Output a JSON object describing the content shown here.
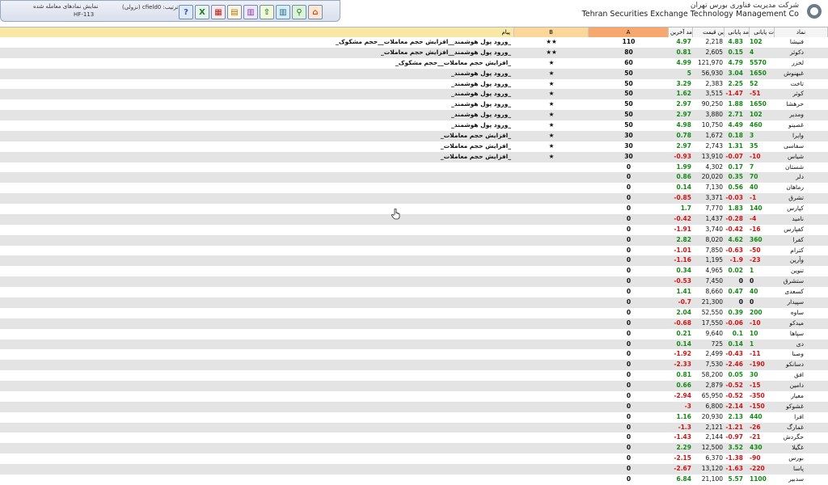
{
  "header": {
    "show_traded_label": "نمایش نمادهای معامله شده",
    "code": "HF-113",
    "sort_label": "ترتیب: cfield0 (نزولی)",
    "company_fa": "شرکت مدیریت فناوری بورس تهران",
    "company_en": "Tehran Securities Exchange Technology Management Co",
    "toolbar": [
      {
        "name": "help-button",
        "icon": "question-icon",
        "glyph": "?",
        "color": "#2a5db0",
        "bg": "#dfe9f7"
      },
      {
        "name": "excel-button",
        "icon": "excel-icon",
        "glyph": "X",
        "color": "#1e7a32",
        "bg": "#e9f4ea"
      },
      {
        "name": "grid-button",
        "icon": "grid-icon",
        "glyph": "▦",
        "color": "#b02020",
        "bg": "#fbe9e9"
      },
      {
        "name": "preview-button",
        "icon": "document-icon",
        "glyph": "▤",
        "color": "#a07a20",
        "bg": "#fff6dd"
      },
      {
        "name": "table-button",
        "icon": "table-icon",
        "glyph": "▥",
        "color": "#7a3aa8",
        "bg": "#f1e6f8"
      },
      {
        "name": "up-button",
        "icon": "arrow-up-icon",
        "glyph": "⇧",
        "color": "#1e7a32",
        "bg": "#f3f8d6"
      },
      {
        "name": "columns-button",
        "icon": "columns-icon",
        "glyph": "▥",
        "color": "#1e6a8a",
        "bg": "#d7eef7"
      },
      {
        "name": "search-button",
        "icon": "search-icon",
        "glyph": "⚲",
        "color": "#1a7a1a",
        "bg": "#dff2d9"
      },
      {
        "name": "home-button",
        "icon": "home-icon",
        "glyph": "⌂",
        "color": "#d04a1a",
        "bg": "#fde6d6"
      }
    ]
  },
  "columns": {
    "symbol": "نماد",
    "close_change": "ت پایانی",
    "close_pct": "مد پایانی",
    "last_price": "ین قیمت",
    "last_pct": "مد آخرین",
    "a": "A",
    "b": "B",
    "message": "پیام"
  },
  "colors": {
    "positive": "#148a14",
    "negative": "#d01414",
    "header_a": "#f7a86e",
    "header_b": "#fbd79a",
    "header_msg": "#f9e7a6",
    "header_other": "#f4f4f4"
  },
  "rows": [
    {
      "symbol": "فنیشا",
      "c1": "102",
      "c2": "4.83",
      "c3": "2,218",
      "c4": "4.97",
      "a": "110",
      "b": "★★",
      "msg": "_ورود پول هوشمند__افزایش حجم معاملات__حجم مشکوک_"
    },
    {
      "symbol": "دکوثر",
      "c1": "4",
      "c2": "0.15",
      "c3": "2,605",
      "c4": "0.81",
      "a": "80",
      "b": "★★",
      "msg": "_ورود پول هوشمند__افزایش حجم معاملات_"
    },
    {
      "symbol": "لخزر",
      "c1": "5570",
      "c2": "4.79",
      "c3": "121,970",
      "c4": "4.99",
      "a": "60",
      "b": "★",
      "msg": "_افزایش حجم معاملات__حجم مشکوک_"
    },
    {
      "symbol": "غبهنوش",
      "c1": "1650",
      "c2": "3.04",
      "c3": "56,930",
      "c4": "5",
      "a": "50",
      "b": "★",
      "msg": "_ورود پول هوشمند_"
    },
    {
      "symbol": "تاخت",
      "c1": "52",
      "c2": "2.25",
      "c3": "2,383",
      "c4": "3.29",
      "a": "50",
      "b": "★",
      "msg": "_ورود پول هوشمند_"
    },
    {
      "symbol": "کوثر",
      "c1": "-51",
      "c2": "-1.47",
      "c3": "3,515",
      "c4": "1.62",
      "a": "50",
      "b": "★",
      "msg": "_ورود پول هوشمند_"
    },
    {
      "symbol": "حرهشا",
      "c1": "1650",
      "c2": "1.88",
      "c3": "90,250",
      "c4": "2.97",
      "a": "50",
      "b": "★",
      "msg": "_ورود پول هوشمند_"
    },
    {
      "symbol": "ومدیر",
      "c1": "102",
      "c2": "2.71",
      "c3": "3,880",
      "c4": "2.97",
      "a": "50",
      "b": "★",
      "msg": "_ورود پول هوشمند_"
    },
    {
      "symbol": "غصینو",
      "c1": "460",
      "c2": "4.49",
      "c3": "10,750",
      "c4": "4.98",
      "a": "50",
      "b": "★",
      "msg": "_ورود پول هوشمند_"
    },
    {
      "symbol": "وایرا",
      "c1": "3",
      "c2": "0.18",
      "c3": "1,672",
      "c4": "0.78",
      "a": "30",
      "b": "★",
      "msg": "_افزایش حجم معاملات_"
    },
    {
      "symbol": "سفاسی",
      "c1": "35",
      "c2": "1.31",
      "c3": "2,743",
      "c4": "2.97",
      "a": "30",
      "b": "★",
      "msg": "_افزایش حجم معاملات_"
    },
    {
      "symbol": "شیاس",
      "c1": "-10",
      "c2": "-0.07",
      "c3": "13,910",
      "c4": "-0.93",
      "a": "30",
      "b": "★",
      "msg": "_افزایش حجم معاملات_"
    },
    {
      "symbol": "شستان",
      "c1": "7",
      "c2": "0.17",
      "c3": "4,302",
      "c4": "1.99",
      "a": "0",
      "b": "",
      "msg": ""
    },
    {
      "symbol": "دلر",
      "c1": "70",
      "c2": "0.35",
      "c3": "20,020",
      "c4": "0.86",
      "a": "0",
      "b": "",
      "msg": ""
    },
    {
      "symbol": "رماهان",
      "c1": "40",
      "c2": "0.56",
      "c3": "7,130",
      "c4": "0.14",
      "a": "0",
      "b": "",
      "msg": ""
    },
    {
      "symbol": "تشرق",
      "c1": "-1",
      "c2": "-0.03",
      "c3": "3,371",
      "c4": "-0.85",
      "a": "0",
      "b": "",
      "msg": ""
    },
    {
      "symbol": "کپارس",
      "c1": "140",
      "c2": "1.83",
      "c3": "7,770",
      "c4": "1.7",
      "a": "0",
      "b": "",
      "msg": ""
    },
    {
      "symbol": "نامید",
      "c1": "-4",
      "c2": "-0.28",
      "c3": "1,437",
      "c4": "-0.42",
      "a": "0",
      "b": "",
      "msg": ""
    },
    {
      "symbol": "کفپارس",
      "c1": "-16",
      "c2": "-0.42",
      "c3": "3,740",
      "c4": "-1.91",
      "a": "0",
      "b": "",
      "msg": ""
    },
    {
      "symbol": "کفرا",
      "c1": "360",
      "c2": "4.62",
      "c3": "8,020",
      "c4": "2.82",
      "a": "0",
      "b": "",
      "msg": ""
    },
    {
      "symbol": "کترام",
      "c1": "-50",
      "c2": "-0.63",
      "c3": "7,850",
      "c4": "-1.01",
      "a": "0",
      "b": "",
      "msg": ""
    },
    {
      "symbol": "وآرین",
      "c1": "-23",
      "c2": "-1.9",
      "c3": "1,195",
      "c4": "-1.16",
      "a": "0",
      "b": "",
      "msg": ""
    },
    {
      "symbol": "تنوین",
      "c1": "1",
      "c2": "0.02",
      "c3": "4,965",
      "c4": "0.34",
      "a": "0",
      "b": "",
      "msg": ""
    },
    {
      "symbol": "ستشرق",
      "c1": "0",
      "c2": "0",
      "c3": "7,450",
      "c4": "-0.53",
      "a": "0",
      "b": "",
      "msg": ""
    },
    {
      "symbol": "کسعدی",
      "c1": "40",
      "c2": "0.47",
      "c3": "8,660",
      "c4": "1.41",
      "a": "0",
      "b": "",
      "msg": ""
    },
    {
      "symbol": "سپیدار",
      "c1": "0",
      "c2": "0",
      "c3": "21,300",
      "c4": "-0.7",
      "a": "0",
      "b": "",
      "msg": ""
    },
    {
      "symbol": "ساوه",
      "c1": "200",
      "c2": "0.39",
      "c3": "52,550",
      "c4": "2.04",
      "a": "0",
      "b": "",
      "msg": ""
    },
    {
      "symbol": "میدکو",
      "c1": "-10",
      "c2": "-0.06",
      "c3": "17,550",
      "c4": "-0.68",
      "a": "0",
      "b": "",
      "msg": ""
    },
    {
      "symbol": "سپاها",
      "c1": "10",
      "c2": "0.1",
      "c3": "9,640",
      "c4": "0.21",
      "a": "0",
      "b": "",
      "msg": ""
    },
    {
      "symbol": "دی",
      "c1": "1",
      "c2": "0.14",
      "c3": "725",
      "c4": "0.14",
      "a": "0",
      "b": "",
      "msg": ""
    },
    {
      "symbol": "وصنا",
      "c1": "-11",
      "c2": "-0.43",
      "c3": "2,499",
      "c4": "-1.92",
      "a": "0",
      "b": "",
      "msg": ""
    },
    {
      "symbol": "دسانکو",
      "c1": "-190",
      "c2": "-2.46",
      "c3": "7,530",
      "c4": "-2.33",
      "a": "0",
      "b": "",
      "msg": ""
    },
    {
      "symbol": "افق",
      "c1": "30",
      "c2": "0.05",
      "c3": "58,200",
      "c4": "0.81",
      "a": "0",
      "b": "",
      "msg": ""
    },
    {
      "symbol": "دامین",
      "c1": "-15",
      "c2": "-0.52",
      "c3": "2,879",
      "c4": "0.66",
      "a": "0",
      "b": "",
      "msg": ""
    },
    {
      "symbol": "معیار",
      "c1": "-350",
      "c2": "-0.52",
      "c3": "65,950",
      "c4": "-2.94",
      "a": "0",
      "b": "",
      "msg": ""
    },
    {
      "symbol": "غشوکو",
      "c1": "-150",
      "c2": "-2.14",
      "c3": "6,800",
      "c4": "-3",
      "a": "0",
      "b": "",
      "msg": ""
    },
    {
      "symbol": "افرا",
      "c1": "440",
      "c2": "2.13",
      "c3": "20,930",
      "c4": "1.16",
      "a": "0",
      "b": "",
      "msg": ""
    },
    {
      "symbol": "غمارگ",
      "c1": "-26",
      "c2": "-1.21",
      "c3": "2,121",
      "c4": "-1.3",
      "a": "0",
      "b": "",
      "msg": ""
    },
    {
      "symbol": "حگردش",
      "c1": "-21",
      "c2": "-0.97",
      "c3": "2,144",
      "c4": "-1.43",
      "a": "0",
      "b": "",
      "msg": ""
    },
    {
      "symbol": "غگیلا",
      "c1": "430",
      "c2": "3.52",
      "c3": "12,500",
      "c4": "2.29",
      "a": "0",
      "b": "",
      "msg": ""
    },
    {
      "symbol": "بورس",
      "c1": "-90",
      "c2": "-1.38",
      "c3": "6,370",
      "c4": "-2.15",
      "a": "0",
      "b": "",
      "msg": ""
    },
    {
      "symbol": "پاسا",
      "c1": "-220",
      "c2": "-1.63",
      "c3": "13,120",
      "c4": "-2.67",
      "a": "0",
      "b": "",
      "msg": ""
    },
    {
      "symbol": "سدبیر",
      "c1": "1100",
      "c2": "5.57",
      "c3": "21,100",
      "c4": "6.84",
      "a": "0",
      "b": "",
      "msg": ""
    }
  ]
}
